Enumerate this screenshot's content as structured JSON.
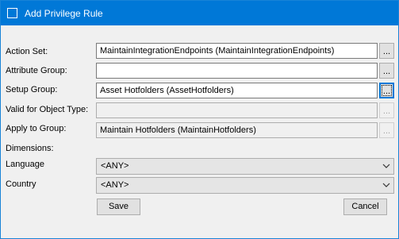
{
  "window": {
    "title": "Add Privilege Rule"
  },
  "labels": {
    "action_set": "Action Set:",
    "attribute_group": "Attribute Group:",
    "setup_group": "Setup Group:",
    "valid_for_object_type": "Valid for Object Type:",
    "apply_to_group": "Apply to Group:",
    "dimensions": "Dimensions:",
    "language": "Language",
    "country": "Country"
  },
  "fields": {
    "action_set": "MaintainIntegrationEndpoints (MaintainIntegrationEndpoints)",
    "attribute_group": "",
    "setup_group": "Asset Hotfolders (AssetHotfolders)",
    "valid_for_object_type": "",
    "apply_to_group": "Maintain Hotfolders (MaintainHotfolders)"
  },
  "browse_label": "...",
  "dropdowns": {
    "language": "<ANY>",
    "country": "<ANY>"
  },
  "buttons": {
    "save": "Save",
    "cancel": "Cancel"
  },
  "colors": {
    "title_bar": "#0078d7",
    "window_bg": "#f0f0f0",
    "focus_border": "#0078d7"
  }
}
